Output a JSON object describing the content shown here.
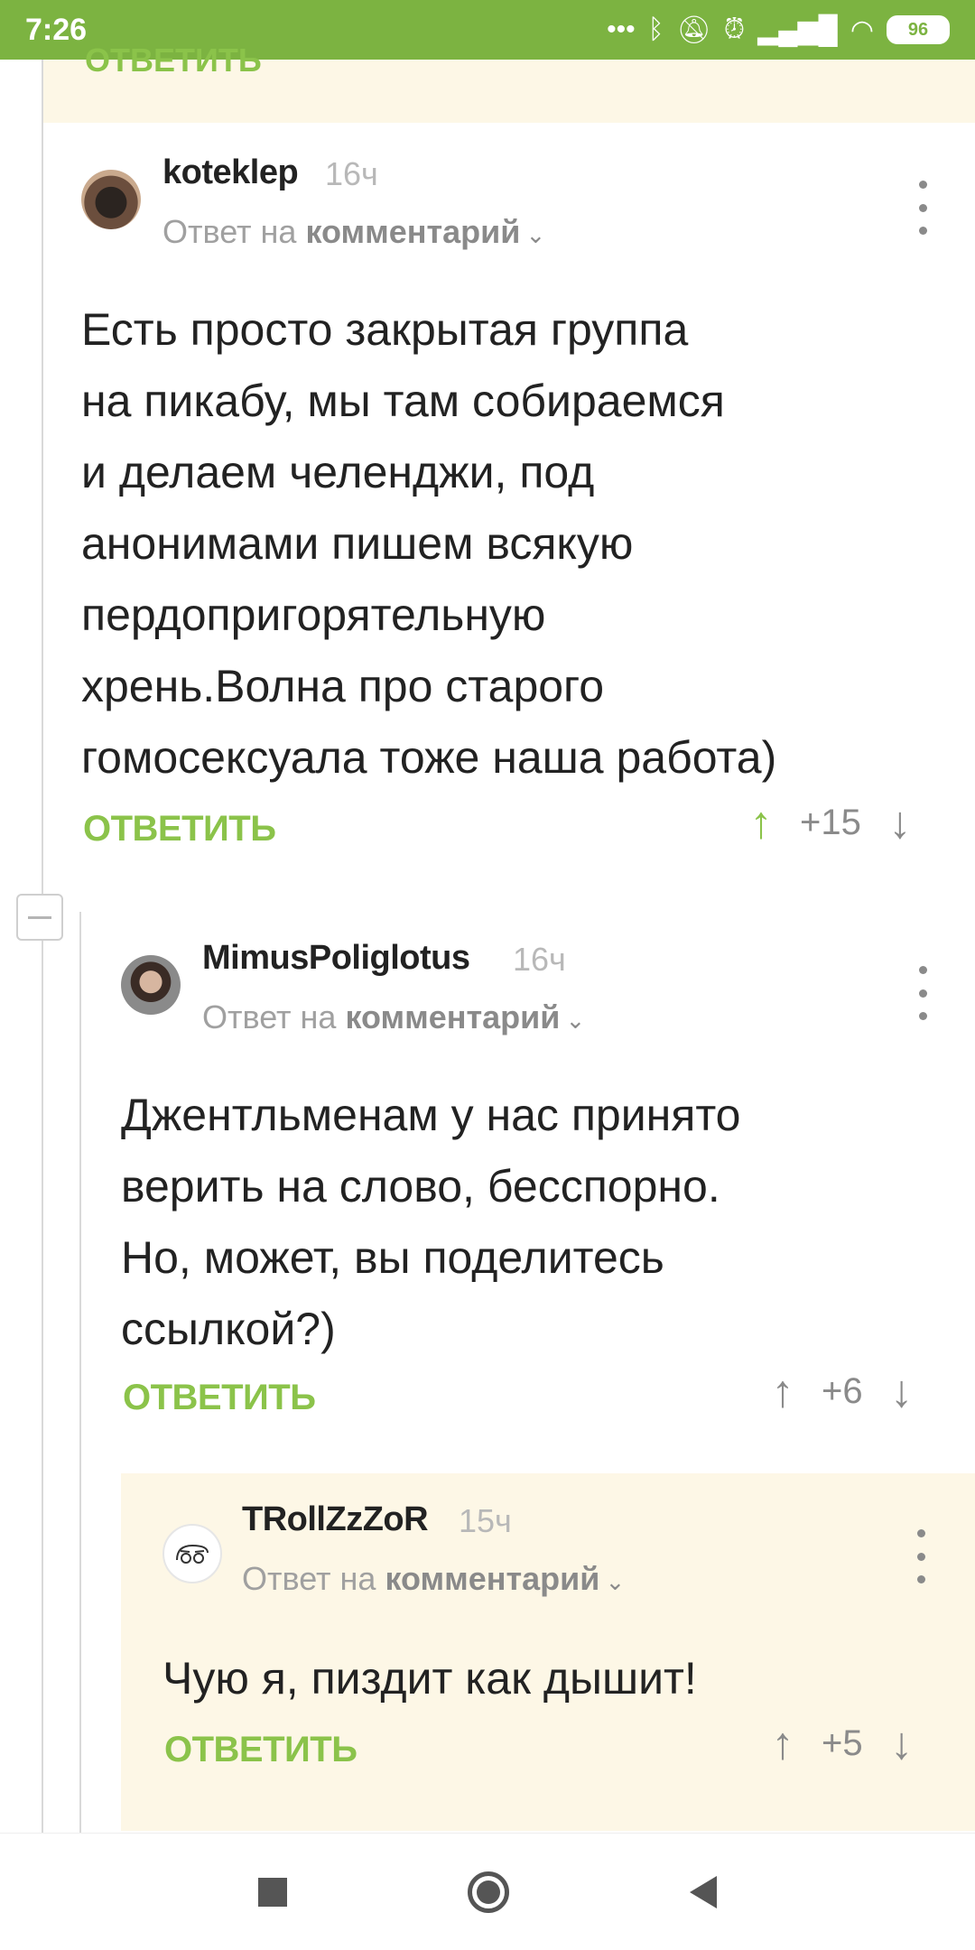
{
  "status_bar": {
    "time": "7:26",
    "icons": [
      "dots-icon",
      "bluetooth-icon",
      "mute-icon",
      "alarm-icon",
      "signal-icon",
      "wifi-icon"
    ],
    "battery": "96"
  },
  "top_partial": {
    "reply_label": "ОТВЕТИТЬ"
  },
  "comments": [
    {
      "username": "koteklep",
      "time": "16ч",
      "reply_prefix": "Ответ на ",
      "reply_target": "комментарий",
      "text_lines": [
        "Есть просто закрытая группа",
        "на пикабу, мы там собираемся",
        "и делаем челенджи, под",
        "анонимами пишем всякую",
        "пердопригорятельную",
        "хрень.Волна про старого",
        "гомосексуала тоже наша работа)"
      ],
      "reply_label": "ОТВЕТИТЬ",
      "score": "+15"
    },
    {
      "username": "MimusPoliglotus",
      "time": "16ч",
      "reply_prefix": "Ответ на ",
      "reply_target": "комментарий",
      "text_lines": [
        "Джентльменам у нас принято",
        "верить на слово, бесспорно.",
        "Но, может, вы поделитесь",
        "ссылкой?)"
      ],
      "reply_label": "ОТВЕТИТЬ",
      "score": "+6"
    },
    {
      "username": "TRollZzZoR",
      "time": "15ч",
      "reply_prefix": "Ответ на ",
      "reply_target": "комментарий",
      "text_lines": [
        "Чую я, пиздит как дышит!"
      ],
      "reply_label": "ОТВЕТИТЬ",
      "score": "+5"
    }
  ],
  "arrows": {
    "up": "↑",
    "down": "↓",
    "chevron": "⌄"
  },
  "colors": {
    "accent": "#8bc34a",
    "status_bar": "#7cb341",
    "highlight_bg": "#fdf7e6"
  }
}
